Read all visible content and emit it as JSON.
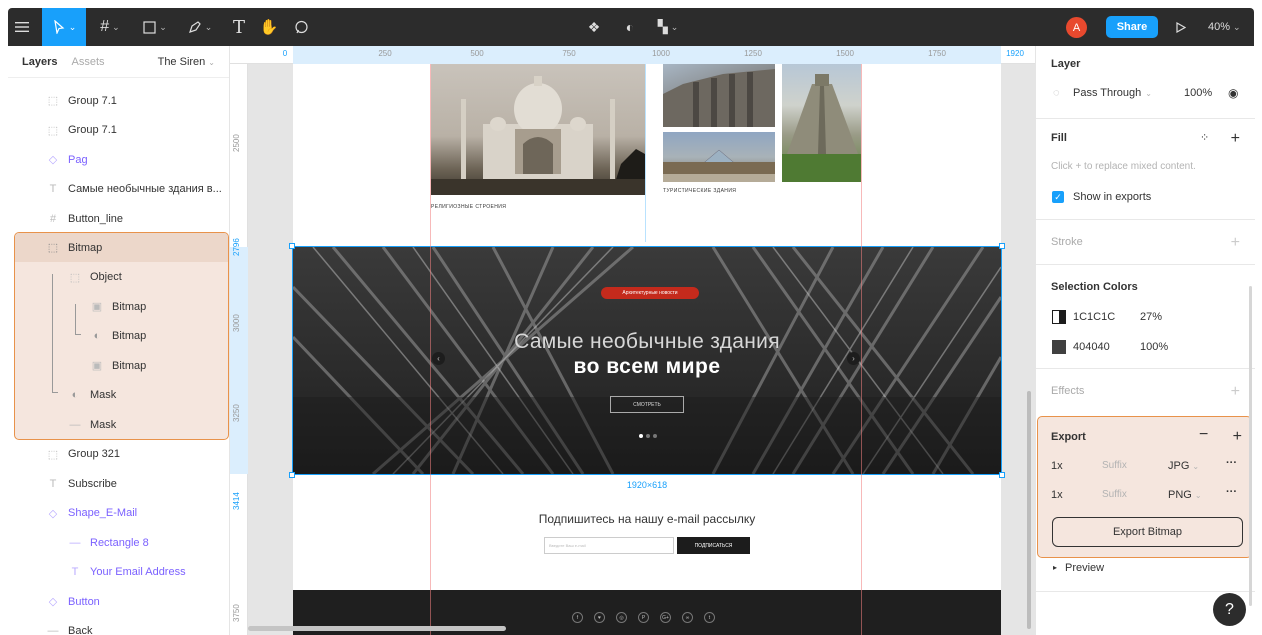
{
  "toolbar": {
    "zoom": "40%",
    "share_label": "Share",
    "avatar_initial": "A"
  },
  "layers_panel": {
    "tab_layers": "Layers",
    "tab_assets": "Assets",
    "page_name": "The Siren",
    "items": [
      {
        "label": "Group 7.1"
      },
      {
        "label": "Group 7.1"
      },
      {
        "label": "Pag"
      },
      {
        "label": "Самые необычные здания в..."
      },
      {
        "label": "Button_line"
      },
      {
        "label": "Bitmap"
      },
      {
        "label": "Object"
      },
      {
        "label": "Bitmap"
      },
      {
        "label": "Bitmap"
      },
      {
        "label": "Bitmap"
      },
      {
        "label": "Mask"
      },
      {
        "label": "Mask"
      },
      {
        "label": "Group 321"
      },
      {
        "label": "Subscribe"
      },
      {
        "label": "Shape_E-Mail"
      },
      {
        "label": "Rectangle 8"
      },
      {
        "label": "Your Email Address"
      },
      {
        "label": "Button"
      },
      {
        "label": "Back"
      }
    ]
  },
  "canvas": {
    "ruler_top": [
      "0",
      "250",
      "500",
      "750",
      "1000",
      "1250",
      "1500",
      "1750",
      "1920"
    ],
    "ruler_left": [
      "2500",
      "2796",
      "3000",
      "3250",
      "3414",
      "3750"
    ],
    "caption_religious": "РЕЛИГИОЗНЫЕ СТРОЕНИЯ",
    "caption_tourist": "ТУРИСТИЧЕСКИЕ ЗДАНИЯ",
    "hero_badge": "Архитектурные новости",
    "hero_title_line1": "Самые необычные здания",
    "hero_title_line2": "во всем мире",
    "hero_button": "СМОТРЕТЬ",
    "size_label": "1920×618",
    "subscribe_title": "Подпишитесь на нашу e-mail рассылку",
    "email_placeholder": "Введите Ваш e-mail",
    "subscribe_button": "ПОДПИСАТЬСЯ",
    "social_icons": [
      "f",
      "♥",
      "◎",
      "P",
      "G+",
      "∞",
      "t"
    ]
  },
  "properties_panel": {
    "layer_title": "Layer",
    "blend_mode": "Pass Through",
    "opacity": "100%",
    "fill_title": "Fill",
    "fill_hint": "Click + to replace mixed content.",
    "show_in_exports": "Show in exports",
    "stroke_title": "Stroke",
    "selection_colors_title": "Selection Colors",
    "colors": [
      {
        "hex": "1C1C1C",
        "opacity": "27%"
      },
      {
        "hex": "404040",
        "opacity": "100%"
      }
    ],
    "effects_title": "Effects",
    "export_title": "Export",
    "export_rows": [
      {
        "scale": "1x",
        "suffix": "Suffix",
        "format": "JPG"
      },
      {
        "scale": "1x",
        "suffix": "Suffix",
        "format": "PNG"
      }
    ],
    "export_button": "Export Bitmap",
    "preview_label": "Preview",
    "help": "?"
  }
}
